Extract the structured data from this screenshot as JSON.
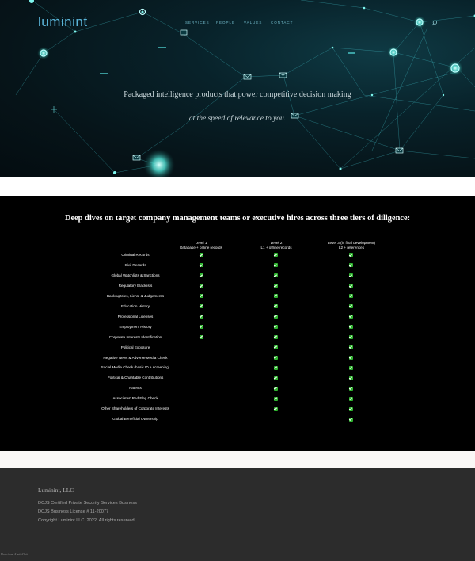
{
  "brand": {
    "logo": "luminint"
  },
  "nav": {
    "items": [
      "SERVICES",
      "PEOPLE",
      "VALUES",
      "CONTACT"
    ]
  },
  "hero": {
    "tagline_1": "Packaged intelligence products that power competitive decision making",
    "tagline_2": "at the speed of relevance to you."
  },
  "diligence": {
    "title": "Deep dives on target company management teams or executive hires across three tiers of diligence:",
    "columns": [
      {
        "line1": "Level 1",
        "line2": "Database + online records"
      },
      {
        "line1": "Level 2",
        "line2": "L1 + offline records"
      },
      {
        "line1": "Level 3 (in final development)",
        "line2": "L2 + references"
      }
    ],
    "rows": [
      {
        "label": "Criminal Records",
        "checks": [
          true,
          true,
          true
        ]
      },
      {
        "label": "Civil Records",
        "checks": [
          true,
          true,
          true
        ]
      },
      {
        "label": "Global Watchlists & Sanctions",
        "checks": [
          true,
          true,
          true
        ]
      },
      {
        "label": "Regulatory Blacklists",
        "checks": [
          true,
          true,
          true
        ]
      },
      {
        "label": "Bankruptcies, Liens, & Judgements",
        "checks": [
          true,
          true,
          true
        ]
      },
      {
        "label": "Education History",
        "checks": [
          true,
          true,
          true
        ]
      },
      {
        "label": "Professional Licenses",
        "checks": [
          true,
          true,
          true
        ]
      },
      {
        "label": "Employment History",
        "checks": [
          true,
          true,
          true
        ]
      },
      {
        "label": "Corporate Interests Identification",
        "checks": [
          true,
          true,
          true
        ]
      },
      {
        "label": "Political Exposure",
        "checks": [
          false,
          true,
          true
        ]
      },
      {
        "label": "Negative News & Adverse Media Check",
        "checks": [
          false,
          true,
          true
        ]
      },
      {
        "label": "Social Media Check (basic ID + screening)",
        "checks": [
          false,
          true,
          true
        ]
      },
      {
        "label": "Political & Charitable Contributions",
        "checks": [
          false,
          true,
          true
        ]
      },
      {
        "label": "Patents",
        "checks": [
          false,
          true,
          true
        ]
      },
      {
        "label": "Associates' Red Flag Check",
        "checks": [
          false,
          true,
          true
        ]
      },
      {
        "label": "Other Shareholders of Corporate Interests",
        "checks": [
          false,
          true,
          true
        ]
      },
      {
        "label": "Global Beneficial Ownership",
        "checks": [
          false,
          false,
          true
        ]
      }
    ]
  },
  "footer": {
    "company": "Luminint, LLC",
    "line_1": "DCJS Certified Private Security Services Business",
    "line_2": "DCJS Business License # 11-20077",
    "line_3": "Copyright Luminint LLC, 2022.  All rights reserved."
  },
  "photo_credit": "Photo from Alarifi/Obit",
  "colors": {
    "accent": "#5ab4d8",
    "check": "#2fb52f",
    "hero_bg": "#061419",
    "footer_bg": "#2c2c2c"
  }
}
